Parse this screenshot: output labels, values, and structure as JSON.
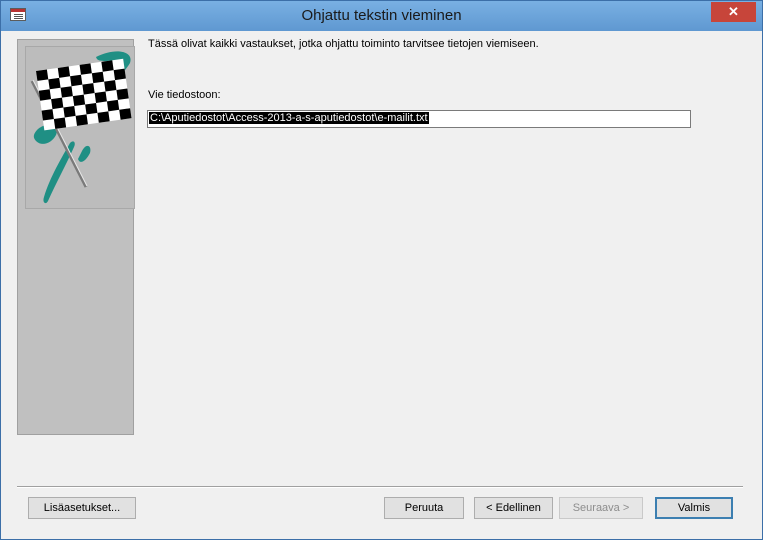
{
  "window": {
    "title": "Ohjattu tekstin vieminen",
    "close_label": "✕"
  },
  "content": {
    "intro_text": "Tässä olivat kaikki vastaukset, jotka ohjattu toiminto tarvitsee tietojen viemiseen.",
    "field_label": "Vie tiedostoon:",
    "file_path": "C:\\Aputiedostot\\Access-2013-a-s-aputiedostot\\e-mailit.txt"
  },
  "side_image": {
    "icon": "checkered-flag-icon",
    "colors": {
      "teal": "#1f8f84",
      "panel": "#c0c0c0"
    }
  },
  "buttons": {
    "advanced": "Lisäasetukset...",
    "cancel": "Peruuta",
    "back": "< Edellinen",
    "next": "Seuraava >",
    "finish": "Valmis"
  }
}
